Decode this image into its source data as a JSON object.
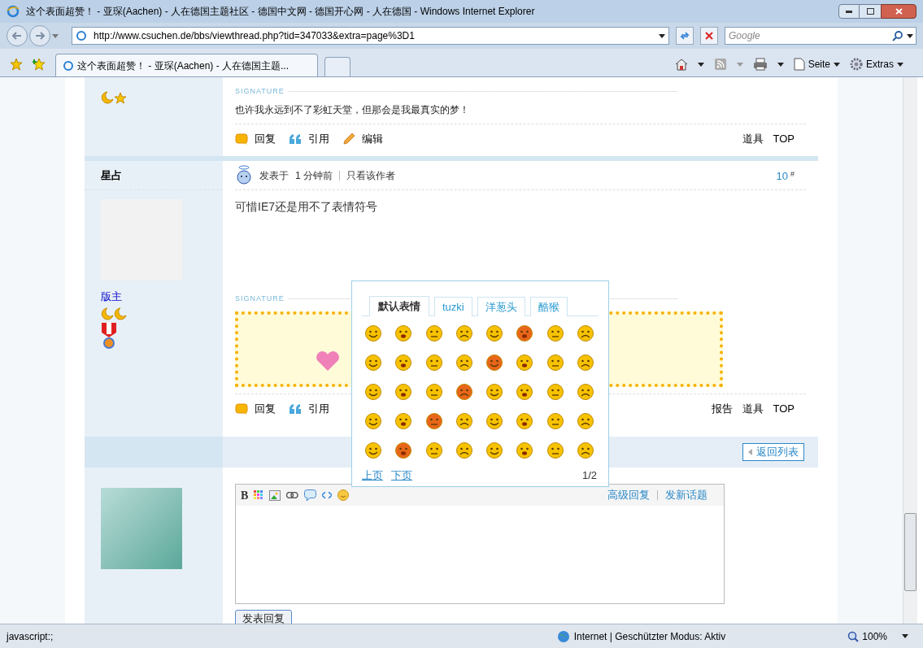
{
  "window": {
    "title": "这个表面超赞！ - 亚琛(Aachen) - 人在德国主题社区 - 德国中文网 - 德国开心网 - 人在德国 - Windows Internet Explorer"
  },
  "address_bar": {
    "url": "http://www.csuchen.de/bbs/viewthread.php?tid=347033&extra=page%3D1"
  },
  "search": {
    "placeholder": "Google"
  },
  "tabs": [
    {
      "label": "这个表面超赞！ - 亚琛(Aachen) - 人在德国主题...",
      "selected": true
    }
  ],
  "command_bar": [
    {
      "label": "Seite",
      "kind": "page"
    },
    {
      "label": "Extras",
      "kind": "tools"
    }
  ],
  "posts": [
    {
      "signature_label": "SIGNATURE",
      "signature_text": "也许我永远到不了彩虹天堂，但那会是我最真实的梦！",
      "actions": [
        {
          "label": "回复",
          "kind": "reply"
        },
        {
          "label": "引用",
          "kind": "quote"
        },
        {
          "label": "编辑",
          "kind": "edit"
        }
      ],
      "links": [
        "道具",
        "TOP"
      ]
    },
    {
      "author": "星占",
      "role": "版主",
      "posted_label": "发表于",
      "time": "1 分钟前",
      "author_only": "只看该作者",
      "floor": "10",
      "floor_mark": "#",
      "message": "可惜IE7还是用不了表情符号",
      "signature_label": "SIGNATURE",
      "actions": [
        {
          "label": "回复",
          "kind": "reply"
        },
        {
          "label": "引用",
          "kind": "quote"
        }
      ],
      "links": [
        "报告",
        "道具",
        "TOP"
      ]
    }
  ],
  "back_button": "返回列表",
  "reply_editor": {
    "bold_label": "B",
    "links": [
      "高级回复",
      "发新话题"
    ],
    "submit": "发表回复"
  },
  "emoticon_popup": {
    "tabs": [
      {
        "label": "默认表情",
        "selected": true
      },
      {
        "label": "tuzki",
        "selected": false
      },
      {
        "label": "洋葱头",
        "selected": false
      },
      {
        "label": "酷猴",
        "selected": false
      }
    ],
    "prev": "上页",
    "next": "下页",
    "page": "1/2"
  },
  "status_bar": {
    "text": "javascript:;",
    "zone": "Internet | Geschützter Modus: Aktiv",
    "zoom": "100%"
  }
}
